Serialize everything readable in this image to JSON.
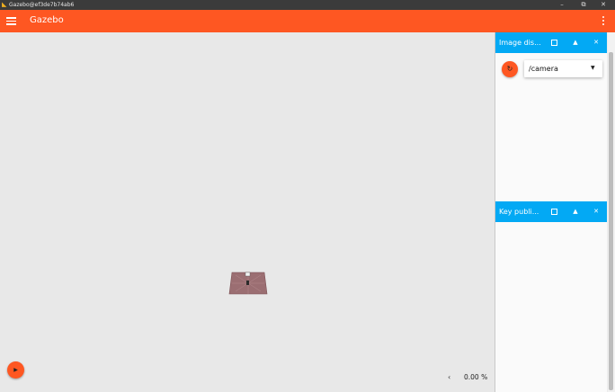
{
  "os_window": {
    "title": "Gazebo@ef3de7b74ab6",
    "minimize_glyph": "–",
    "restore_glyph": "⧉",
    "close_glyph": "✕"
  },
  "app_bar": {
    "title": "Gazebo",
    "accent_color": "#fe5722"
  },
  "scene": {
    "background_color": "#e8e8e8",
    "play_glyph": "▶",
    "rtf_chevron": "‹",
    "real_time_factor": "0.00 %"
  },
  "plugins": [
    {
      "title": "Image dis...",
      "dock_glyph": "□",
      "collapse_glyph": "▲",
      "close_glyph": "✕",
      "refresh_glyph": "↻",
      "topic_value": "/camera",
      "caret_glyph": "▼"
    },
    {
      "title": "Key publi...",
      "dock_glyph": "□",
      "collapse_glyph": "▲",
      "close_glyph": "✕"
    }
  ],
  "colors": {
    "plugin_header": "#03a9f4",
    "panel_background": "#fafafa"
  },
  "icons": [
    "gazebo-app-icon",
    "hamburger-menu-icon",
    "kebab-menu-icon",
    "play-icon",
    "chevron-left-icon",
    "dock-icon",
    "collapse-icon",
    "close-icon",
    "refresh-icon",
    "dropdown-caret-icon"
  ]
}
